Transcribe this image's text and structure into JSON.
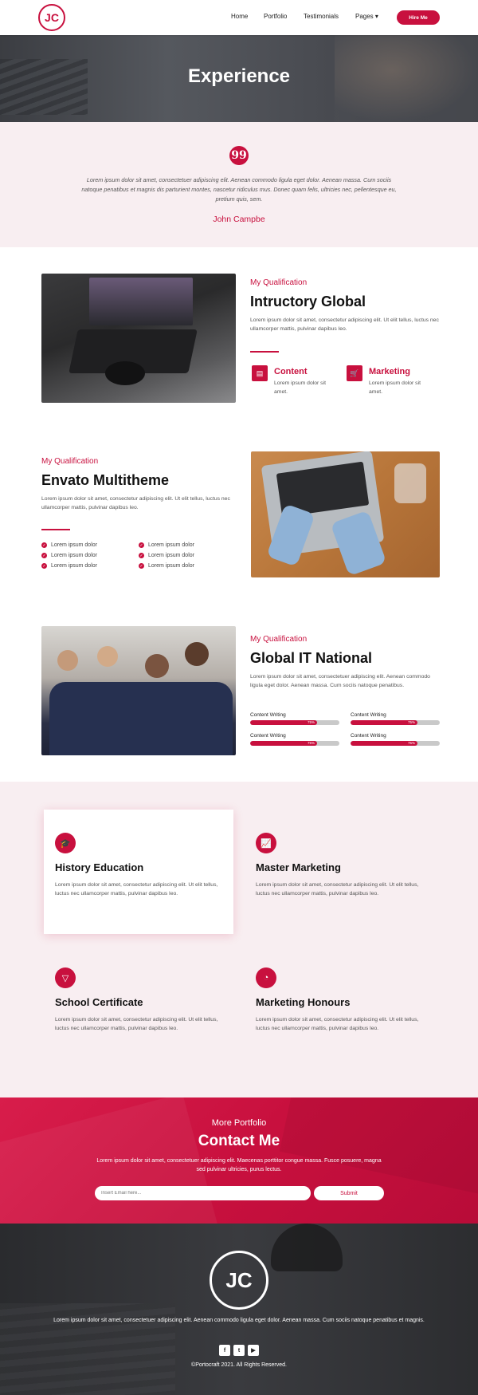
{
  "nav": {
    "logo": "JC",
    "links": [
      "Home",
      "Portfolio",
      "Testimonials",
      "Pages"
    ],
    "pages_caret": "▾",
    "hire_label": "Hire Me"
  },
  "hero": {
    "title": "Experience"
  },
  "testimonial": {
    "quote_mark": "99",
    "text": "Lorem ipsum dolor sit amet, consectetuer adipiscing elit. Aenean commodo ligula eget dolor. Aenean massa. Cum sociis natoque penatibus et magnis dis parturient montes, nascetur ridiculus mus. Donec quam felis, ultricies nec, pellentesque eu, pretium quis, sem.",
    "author": "John Campbe"
  },
  "section1": {
    "kicker": "My Qualification",
    "title": "Intructory Global",
    "text": "Lorem ipsum dolor sit amet, consectetur adipiscing elit. Ut elit tellus, luctus nec ullamcorper mattis, pulvinar dapibus leo.",
    "features": [
      {
        "icon": "document-icon",
        "title": "Content",
        "text": "Lorem ipsum dolor sit amet."
      },
      {
        "icon": "cart-icon",
        "title": "Marketing",
        "text": "Lorem ipsum dolor sit amet."
      }
    ]
  },
  "section2": {
    "kicker": "My Qualification",
    "title": "Envato Multitheme",
    "text": "Lorem ipsum dolor sit amet, consectetur adipiscing elit. Ut elit tellus, luctus nec ullamcorper mattis, pulvinar dapibus leo.",
    "checks": [
      "Lorem ipsum dolor",
      "Lorem ipsum dolor",
      "Lorem ipsum dolor",
      "Lorem ipsum dolor",
      "Lorem ipsum dolor",
      "Lorem ipsum dolor"
    ]
  },
  "section3": {
    "kicker": "My Qualification",
    "title": "Global IT National",
    "text": "Lorem ipsum dolor sit amet, consectetuer adipiscing elit. Aenean commodo ligula eget dolor. Aenean massa. Cum sociis natoque penatibus.",
    "skills": [
      {
        "label": "Content Writing",
        "value": "75%",
        "fraction": 0.75
      },
      {
        "label": "Content Writing",
        "value": "75%",
        "fraction": 0.75
      },
      {
        "label": "Content Writing",
        "value": "75%",
        "fraction": 0.75
      },
      {
        "label": "Content Writing",
        "value": "75%",
        "fraction": 0.75
      }
    ]
  },
  "services": [
    {
      "icon": "graduation-cap-icon",
      "title": "History Education",
      "text": "Lorem ipsum dolor sit amet, consectetur adipiscing elit. Ut elit tellus, luctus nec ullamcorper mattis, pulvinar dapibus leo."
    },
    {
      "icon": "chart-icon",
      "title": "Master Marketing",
      "text": "Lorem ipsum dolor sit amet, consectetur adipiscing elit. Ut elit tellus, luctus nec ullamcorper mattis, pulvinar dapibus leo."
    },
    {
      "icon": "badge-icon",
      "title": "School Certificate",
      "text": "Lorem ipsum dolor sit amet, consectetur adipiscing elit. Ut elit tellus, luctus nec ullamcorper mattis, pulvinar dapibus leo."
    },
    {
      "icon": "pie-chart-icon",
      "title": "Marketing Honours",
      "text": "Lorem ipsum dolor sit amet, consectetur adipiscing elit. Ut elit tellus, luctus nec ullamcorper mattis, pulvinar dapibus leo."
    }
  ],
  "contact": {
    "kicker": "More Portfolio",
    "title": "Contact Me",
    "text": "Lorem ipsum dolor sit amet, consectetuer adipiscing elit. Maecenas porttitor congue massa. Fusce posuere, magna sed pulvinar ultricies, purus lectus.",
    "email_placeholder": "Insert Email here...",
    "submit_label": "Submit"
  },
  "footer": {
    "logo": "JC",
    "text": "Lorem ipsum dolor sit amet, consectetuer adipiscing elit. Aenean commodo ligula eget dolor. Aenean massa. Cum sociis natoque penatibus et magnis.",
    "socials": [
      {
        "icon": "facebook-icon",
        "glyph": "f"
      },
      {
        "icon": "twitter-icon",
        "glyph": "t"
      },
      {
        "icon": "youtube-icon",
        "glyph": "▶"
      }
    ],
    "copyright": "©Portocraft 2021. All Rights Reserved."
  },
  "colors": {
    "accent": "#c8103e",
    "pink_bg": "#f8eef1",
    "dark": "#2e2f33"
  }
}
